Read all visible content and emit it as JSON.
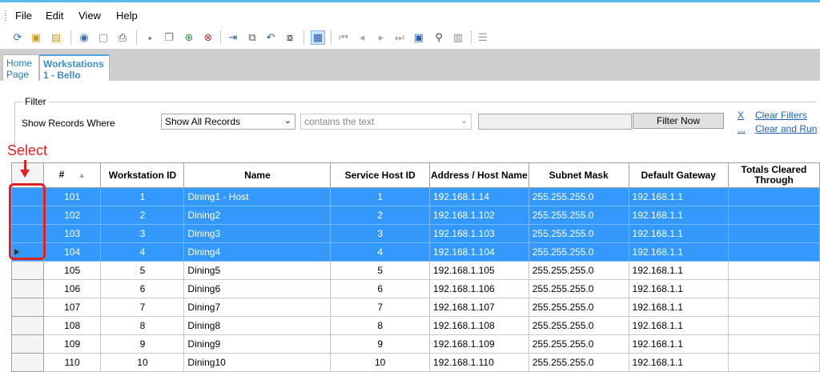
{
  "menu": [
    "File",
    "Edit",
    "View",
    "Help"
  ],
  "toolbar_icons": [
    "refresh-icon",
    "open-folder-icon",
    "folder-icon",
    "record-icon",
    "report-icon",
    "print-icon",
    "save-icon",
    "copy-save-icon",
    "add-icon",
    "delete-icon",
    "import-icon",
    "duplicate-icon",
    "undo-icon",
    "paste-icon",
    "grid-view-icon",
    "first-record-icon",
    "previous-record-icon",
    "next-record-icon",
    "last-record-icon",
    "go-to-record-icon",
    "find-icon",
    "form-icon",
    "table-icon"
  ],
  "tabs": [
    {
      "line1": "Home",
      "line2": "Page"
    },
    {
      "line1": "Workstations",
      "line2": "1 - Bello"
    }
  ],
  "filter": {
    "legend": "Filter",
    "label": "Show Records Where",
    "field_value": "Show All Records",
    "operator_value": "contains the text",
    "button": "Filter Now",
    "clear_short": "X",
    "clear_link": "Clear Filters",
    "run_short": "...",
    "run_link": "Clear and Run"
  },
  "annotation": "Select",
  "grid": {
    "columns": [
      "#",
      "Workstation ID",
      "Name",
      "Service Host ID",
      "Address / Host Name",
      "Subnet Mask",
      "Default Gateway",
      "Totals Cleared Through"
    ],
    "rows": [
      {
        "num": "101",
        "ws": "1",
        "name": "Dining1 - Host",
        "host": "1",
        "addr": "192.168.1.14",
        "mask": "255.255.255.0",
        "gw": "192.168.1.1",
        "totals": ""
      },
      {
        "num": "102",
        "ws": "2",
        "name": "Dining2",
        "host": "2",
        "addr": "192.168.1.102",
        "mask": "255.255.255.0",
        "gw": "192.168.1.1",
        "totals": ""
      },
      {
        "num": "103",
        "ws": "3",
        "name": "Dining3",
        "host": "3",
        "addr": "192.168.1.103",
        "mask": "255.255.255.0",
        "gw": "192.168.1.1",
        "totals": ""
      },
      {
        "num": "104",
        "ws": "4",
        "name": "Dining4",
        "host": "4",
        "addr": "192.168.1.104",
        "mask": "255.255.255.0",
        "gw": "192.168.1.1",
        "totals": ""
      },
      {
        "num": "105",
        "ws": "5",
        "name": "Dining5",
        "host": "5",
        "addr": "192.168.1.105",
        "mask": "255.255.255.0",
        "gw": "192.168.1.1",
        "totals": ""
      },
      {
        "num": "106",
        "ws": "6",
        "name": "Dining6",
        "host": "6",
        "addr": "192.168.1.106",
        "mask": "255.255.255.0",
        "gw": "192.168.1.1",
        "totals": ""
      },
      {
        "num": "107",
        "ws": "7",
        "name": "Dining7",
        "host": "7",
        "addr": "192.168.1.107",
        "mask": "255.255.255.0",
        "gw": "192.168.1.1",
        "totals": ""
      },
      {
        "num": "108",
        "ws": "8",
        "name": "Dining8",
        "host": "8",
        "addr": "192.168.1.108",
        "mask": "255.255.255.0",
        "gw": "192.168.1.1",
        "totals": ""
      },
      {
        "num": "109",
        "ws": "9",
        "name": "Dining9",
        "host": "9",
        "addr": "192.168.1.109",
        "mask": "255.255.255.0",
        "gw": "192.168.1.1",
        "totals": ""
      },
      {
        "num": "110",
        "ws": "10",
        "name": "Dining10",
        "host": "10",
        "addr": "192.168.1.110",
        "mask": "255.255.255.0",
        "gw": "192.168.1.1",
        "totals": ""
      }
    ],
    "selected_rows": [
      0,
      1,
      2,
      3
    ],
    "current_row": 3
  },
  "colors": {
    "selection": "#3399ff",
    "annotation": "#e02222",
    "link": "#1f5fb4"
  }
}
